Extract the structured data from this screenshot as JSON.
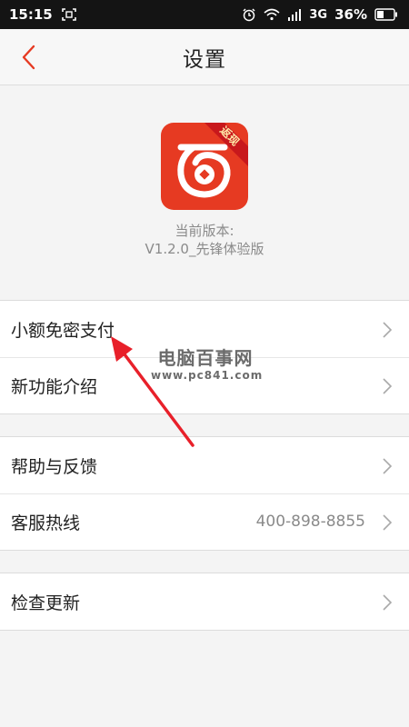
{
  "status_bar": {
    "time": "15:15",
    "network": "3G",
    "battery": "36%"
  },
  "header": {
    "title": "设置"
  },
  "app_info": {
    "badge": "返现",
    "version_label": "当前版本:",
    "version_value": "V1.2.0_先锋体验版"
  },
  "groups": [
    {
      "items": [
        {
          "label": "小额免密支付"
        },
        {
          "label": "新功能介绍"
        }
      ]
    },
    {
      "items": [
        {
          "label": "帮助与反馈"
        },
        {
          "label": "客服热线",
          "value": "400-898-8855"
        }
      ]
    },
    {
      "items": [
        {
          "label": "检查更新"
        }
      ]
    }
  ],
  "watermark": {
    "title": "电脑百事网",
    "url": "www.pc841.com"
  },
  "colors": {
    "accent": "#e63a22",
    "annotation": "#e8202a",
    "status_bar": "#141414"
  },
  "icons": {
    "back": "chevron-left-icon",
    "row": "chevron-right-icon"
  }
}
